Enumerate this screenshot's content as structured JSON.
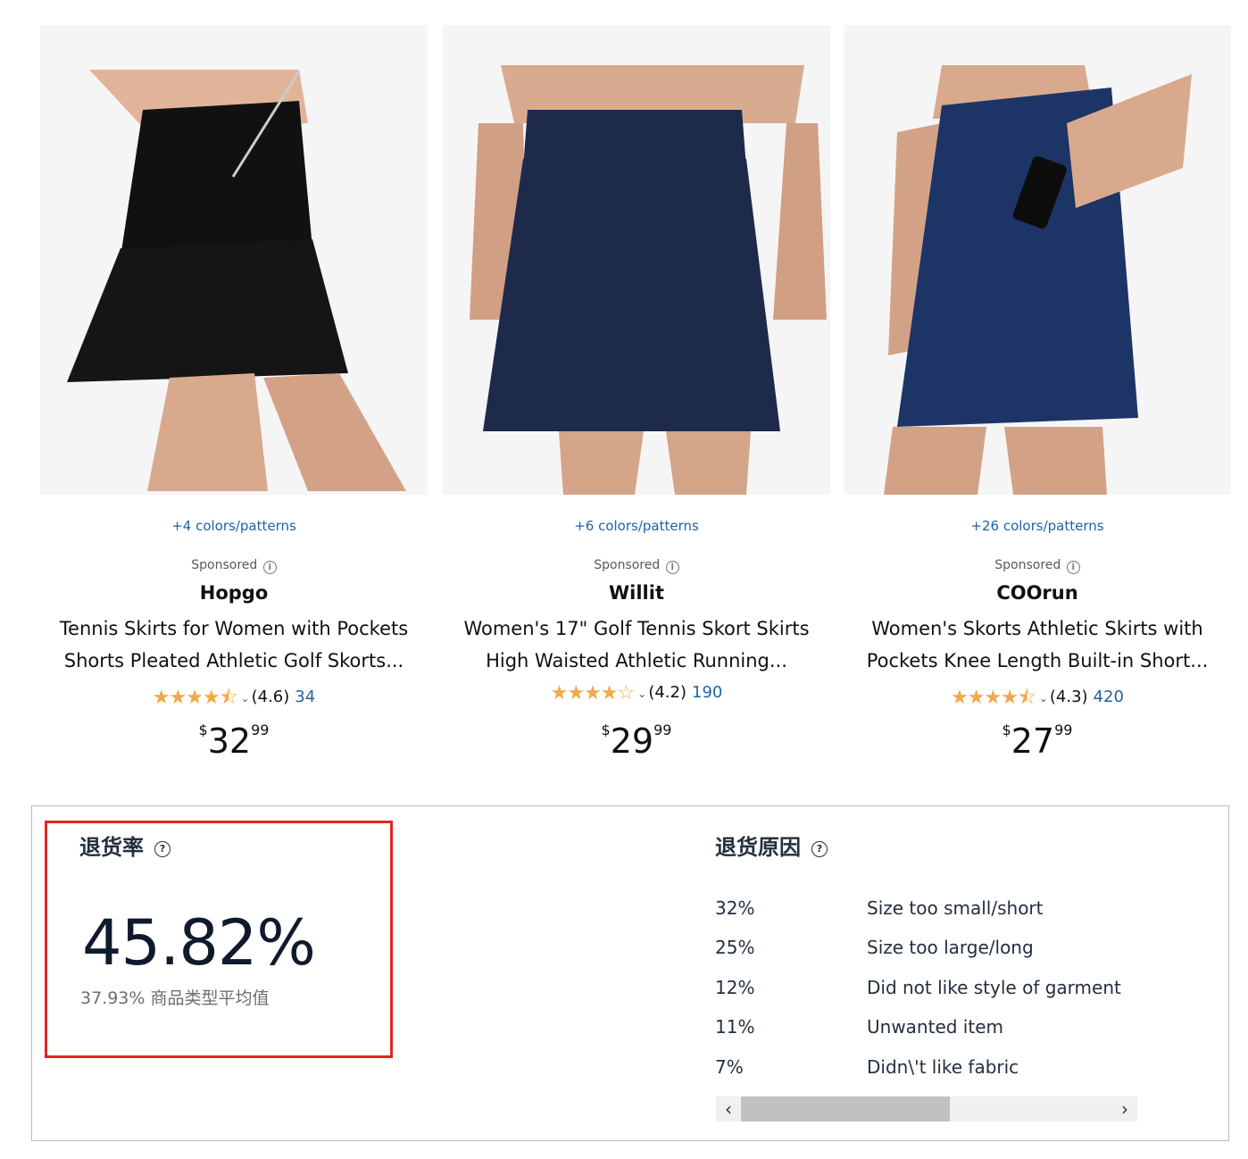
{
  "products": [
    {
      "colors": "+4 colors/patterns",
      "sponsored": "Sponsored",
      "brand": "Hopgo",
      "title_line1": "Tennis Skirts for Women with Pockets",
      "title_line2": "Shorts Pleated Athletic Golf Skorts...",
      "stars": "★★★★⯪",
      "rating": "(4.6)",
      "review_count": "34",
      "price_symbol": "$",
      "price_whole": "32",
      "price_fraction": "99",
      "skirt_color": "#111111"
    },
    {
      "colors": "+6 colors/patterns",
      "sponsored": "Sponsored",
      "brand": "Willit",
      "title_line1": "Women's 17\" Golf Tennis Skort Skirts",
      "title_line2": "High Waisted Athletic Running...",
      "stars": "★★★★☆",
      "rating": "(4.2)",
      "review_count": "190",
      "price_symbol": "$",
      "price_whole": "29",
      "price_fraction": "99",
      "skirt_color": "#1e2a4a"
    },
    {
      "colors": "+26 colors/patterns",
      "sponsored": "Sponsored",
      "brand": "COOrun",
      "title_line1": "Women's Skorts Athletic Skirts with",
      "title_line2": "Pockets Knee Length Built-in Short...",
      "stars": "★★★★⯪",
      "rating": "(4.3)",
      "review_count": "420",
      "price_symbol": "$",
      "price_whole": "27",
      "price_fraction": "99",
      "skirt_color": "#1d3466"
    }
  ],
  "return_rate": {
    "title": "退货率",
    "value": "45.82%",
    "average_value": "37.93%",
    "average_label": "商品类型平均值"
  },
  "return_reasons": {
    "title": "退货原因",
    "items": [
      {
        "pct": "32%",
        "reason": "Size too small/short"
      },
      {
        "pct": "25%",
        "reason": "Size too large/long"
      },
      {
        "pct": "12%",
        "reason": "Did not like style of garment"
      },
      {
        "pct": "11%",
        "reason": "Unwanted item"
      },
      {
        "pct": "7%",
        "reason": "Didn\\'t like fabric"
      }
    ]
  },
  "scroll": {
    "left_label": "‹",
    "right_label": "›"
  },
  "icons": {
    "info": "info-icon",
    "help": "question-circle-icon",
    "star": "star-icon"
  },
  "colors": {
    "link": "#2162a1",
    "star": "#f3a847",
    "highlight": "#e0281e"
  }
}
